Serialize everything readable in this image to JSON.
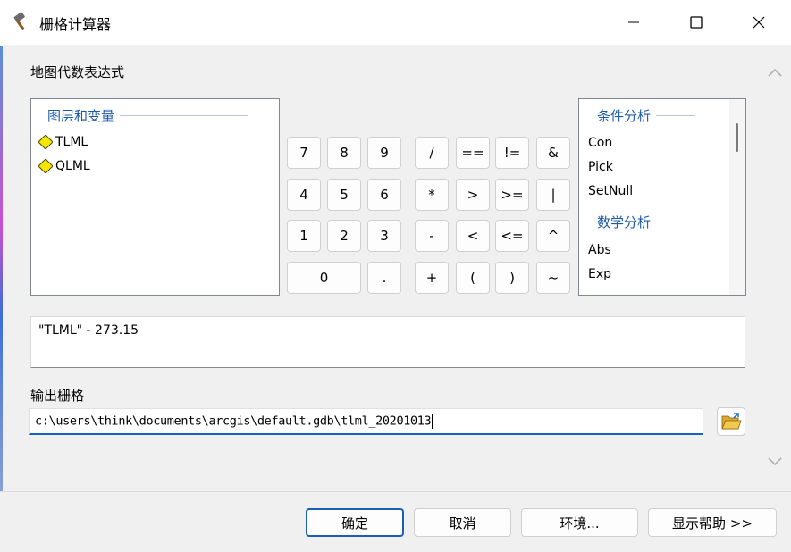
{
  "window": {
    "title": "栅格计算器"
  },
  "expression_section": {
    "label": "地图代数表达式"
  },
  "layers_panel": {
    "group_title": "图层和变量",
    "items": [
      {
        "name": "TLML",
        "icon": "raster-layer-diamond-icon"
      },
      {
        "name": "QLML",
        "icon": "raster-layer-diamond-icon"
      }
    ]
  },
  "keypad": {
    "rows": [
      [
        "7",
        "8",
        "9",
        "/",
        "==",
        "!=",
        "&"
      ],
      [
        "4",
        "5",
        "6",
        "*",
        ">",
        ">=",
        "|"
      ],
      [
        "1",
        "2",
        "3",
        "-",
        "<",
        "<=",
        "^"
      ],
      [
        "0",
        ".",
        "+",
        "(",
        ")",
        "~"
      ]
    ]
  },
  "functions_panel": {
    "groups": [
      {
        "title": "条件分析",
        "items": [
          "Con",
          "Pick",
          "SetNull"
        ]
      },
      {
        "title": "数学分析",
        "items": [
          "Abs",
          "Exp"
        ]
      }
    ]
  },
  "expression": {
    "value": "\"TLML\" - 273.15"
  },
  "output": {
    "label": "输出栅格",
    "value": "c:\\users\\think\\documents\\arcgis\\default.gdb\\tlml_20201013",
    "browse_icon": "open-folder-icon"
  },
  "buttons": {
    "ok": "确定",
    "cancel": "取消",
    "environments": "环境...",
    "help": "显示帮助 >>"
  },
  "colors": {
    "accent": "#1464c8",
    "group_title": "#1e5aa8",
    "diamond_fill": "#f5e600",
    "panel_bg": "#f0f0f0"
  }
}
